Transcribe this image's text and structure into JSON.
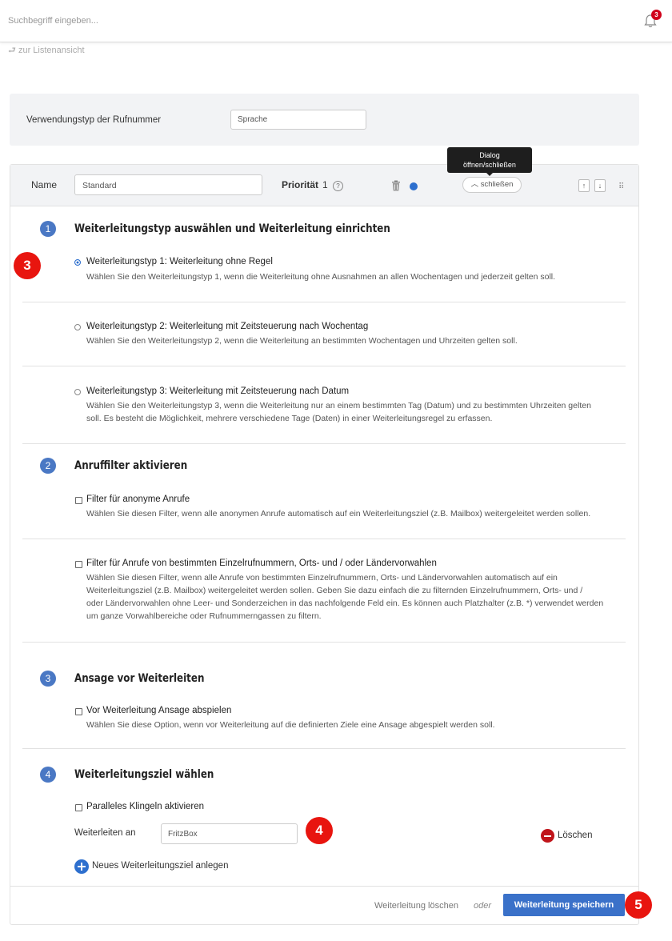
{
  "topbar": {
    "search_placeholder": "Suchbegriff eingeben...",
    "notification_count": "3"
  },
  "back_link": "zur Listenansicht",
  "usage": {
    "label": "Verwendungstyp der Rufnummer",
    "value": "Sprache"
  },
  "tooltip": {
    "line1": "Dialog",
    "line2": "öffnen/schließen"
  },
  "header": {
    "name_label": "Name",
    "name_value": "Standard",
    "priority_label": "Priorität",
    "priority_value": "1",
    "help_glyph": "?",
    "close_label": "schließen",
    "up_glyph": "↑",
    "down_glyph": "↓"
  },
  "sections": [
    {
      "num": "1",
      "title": "Weiterleitungstyp auswählen und Weiterleitung einrichten"
    },
    {
      "num": "2",
      "title": "Anruffilter aktivieren"
    },
    {
      "num": "3",
      "title": "Ansage vor Weiterleiten"
    },
    {
      "num": "4",
      "title": "Weiterleitungsziel wählen"
    }
  ],
  "types": [
    {
      "title": "Weiterleitungstyp 1: Weiterleitung ohne Regel",
      "desc": "Wählen Sie den Weiterleitungstyp 1, wenn die Weiterleitung ohne Ausnahmen an allen Wochentagen und jederzeit gelten soll.",
      "checked": true
    },
    {
      "title": "Weiterleitungstyp 2: Weiterleitung mit Zeitsteuerung nach Wochentag",
      "desc": "Wählen Sie den Weiterleitungstyp 2, wenn die Weiterleitung an bestimmten Wochentagen und Uhrzeiten gelten soll.",
      "checked": false
    },
    {
      "title": "Weiterleitungstyp 3: Weiterleitung mit Zeitsteuerung nach Datum",
      "desc1": "Wählen Sie den Weiterleitungstyp 3, wenn die Weiterleitung nur an einem bestimmten Tag (Datum) und zu bestimmten Uhrzeiten gelten",
      "desc2": "soll. Es besteht die Möglichkeit, mehrere verschiedene Tage (Daten) in einer Weiterleitungsregel zu erfassen.",
      "checked": false
    }
  ],
  "filters": [
    {
      "title": "Filter für anonyme Anrufe",
      "desc": "Wählen Sie diesen Filter, wenn alle anonymen Anrufe automatisch auf ein Weiterleitungsziel (z.B. Mailbox) weitergeleitet werden sollen."
    },
    {
      "title": "Filter für Anrufe von bestimmten Einzelrufnummern, Orts- und / oder Ländervorwahlen",
      "desc1": "Wählen Sie diesen Filter, wenn alle Anrufe von bestimmten Einzelrufnummern, Orts- und Ländervorwahlen automatisch auf ein",
      "desc2": "Weiterleitungsziel (z.B. Mailbox) weitergeleitet werden sollen. Geben Sie dazu einfach die zu filternden Einzelrufnummern, Orts- und /",
      "desc3": "oder Ländervorwahlen ohne Leer- und Sonderzeichen in das nachfolgende Feld ein. Es können auch Platzhalter (z.B. *) verwendet werden",
      "desc4": "um ganze Vorwahlbereiche oder Rufnummerngassen zu filtern."
    }
  ],
  "announce": {
    "title": "Vor Weiterleitung Ansage abspielen",
    "desc": "Wählen Sie diese Option, wenn vor Weiterleitung auf die definierten Ziele eine Ansage abgespielt werden soll."
  },
  "target": {
    "parallel_label": "Paralleles Klingeln aktivieren",
    "forward_label": "Weiterleiten an",
    "forward_value": "FritzBox",
    "delete_label": "Löschen",
    "add_label": "Neues Weiterleitungsziel anlegen"
  },
  "footer": {
    "delete_link": "Weiterleitung löschen",
    "or_text": "oder",
    "save_label": "Weiterleitung speichern"
  },
  "badges": {
    "b3": "3",
    "b4": "4",
    "b5": "5"
  },
  "colors": {
    "accent": "#3a71c9",
    "badge_red": "#e8150f",
    "delete_red": "#c0141a"
  }
}
